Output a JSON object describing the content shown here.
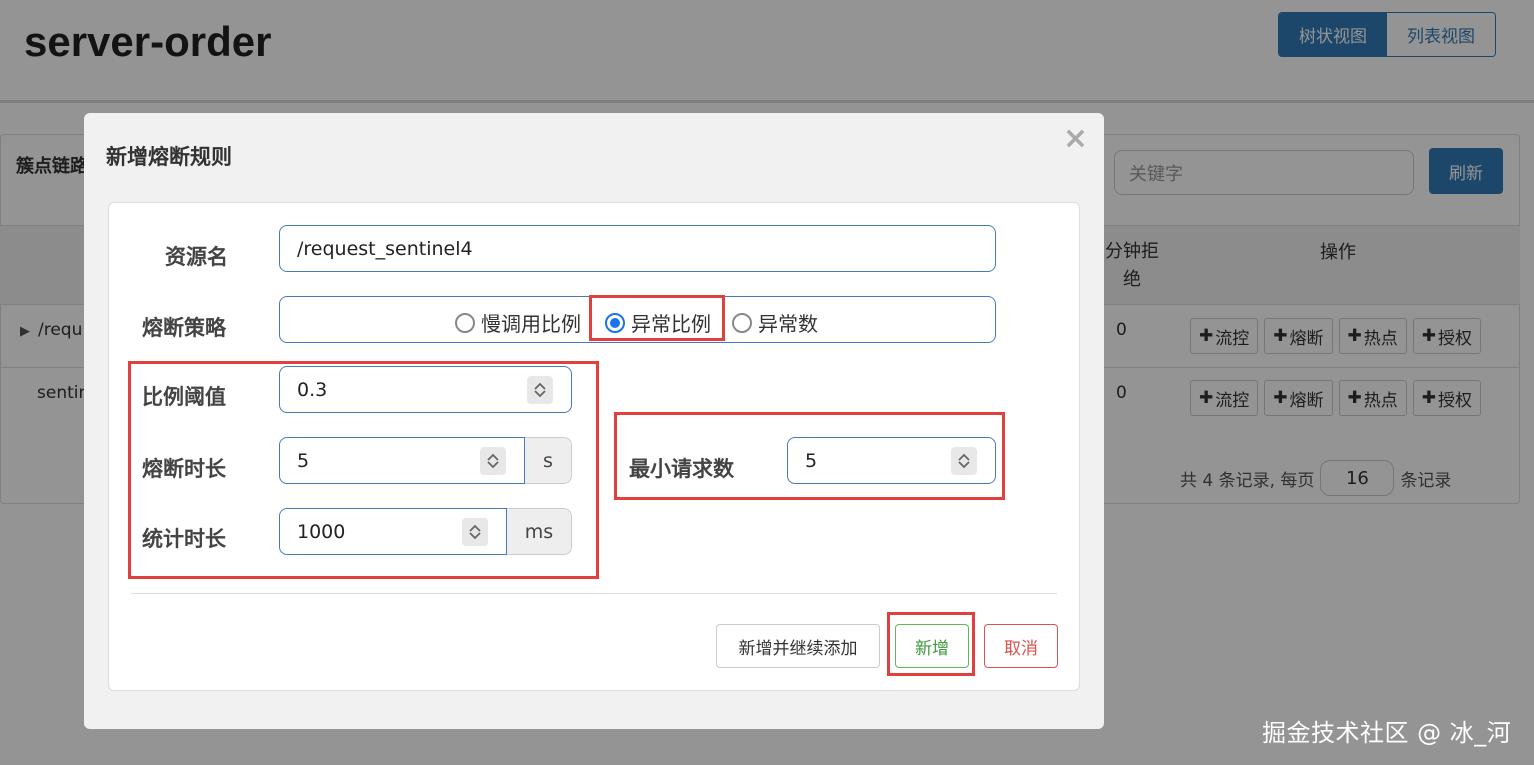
{
  "page": {
    "title": "server-order",
    "view_tabs": [
      "树状视图",
      "列表视图"
    ],
    "panel_header": "簇点链路",
    "search_placeholder": "关键字",
    "refresh_label": "刷新",
    "columns": {
      "reject": "分钟拒绝",
      "reject_line1": "分钟拒",
      "reject_line2": "绝",
      "ops": "操作"
    },
    "rows": [
      {
        "resource": "/requ",
        "reject": "0"
      },
      {
        "resource": "sentin",
        "reject": "0"
      }
    ],
    "op_buttons": [
      "流控",
      "熔断",
      "热点",
      "授权"
    ],
    "pager": {
      "prefix": "共 4 条记录, 每页",
      "page_size": "16",
      "suffix": "条记录"
    },
    "watermark": "掘金技术社区 @ 冰_河"
  },
  "modal": {
    "title": "新增熔断规则",
    "close_glyph": "×",
    "resource_label": "资源名",
    "resource_value": "/request_sentinel4",
    "strategy_label": "熔断策略",
    "strategy_options": [
      {
        "label": "慢调用比例",
        "checked": false
      },
      {
        "label": "异常比例",
        "checked": true
      },
      {
        "label": "异常数",
        "checked": false
      }
    ],
    "ratio_label": "比例阈值",
    "ratio_value": "0.3",
    "duration_label": "熔断时长",
    "duration_value": "5",
    "duration_unit": "s",
    "stat_label": "统计时长",
    "stat_value": "1000",
    "stat_unit": "ms",
    "min_req_label": "最小请求数",
    "min_req_value": "5",
    "buttons": {
      "continue": "新增并继续添加",
      "add": "新增",
      "cancel": "取消"
    }
  },
  "colors": {
    "primary": "#337ab7",
    "highlight": "#e04040",
    "success": "#5cb85c",
    "danger": "#d9534f",
    "radio_checked": "#1a73e8"
  }
}
